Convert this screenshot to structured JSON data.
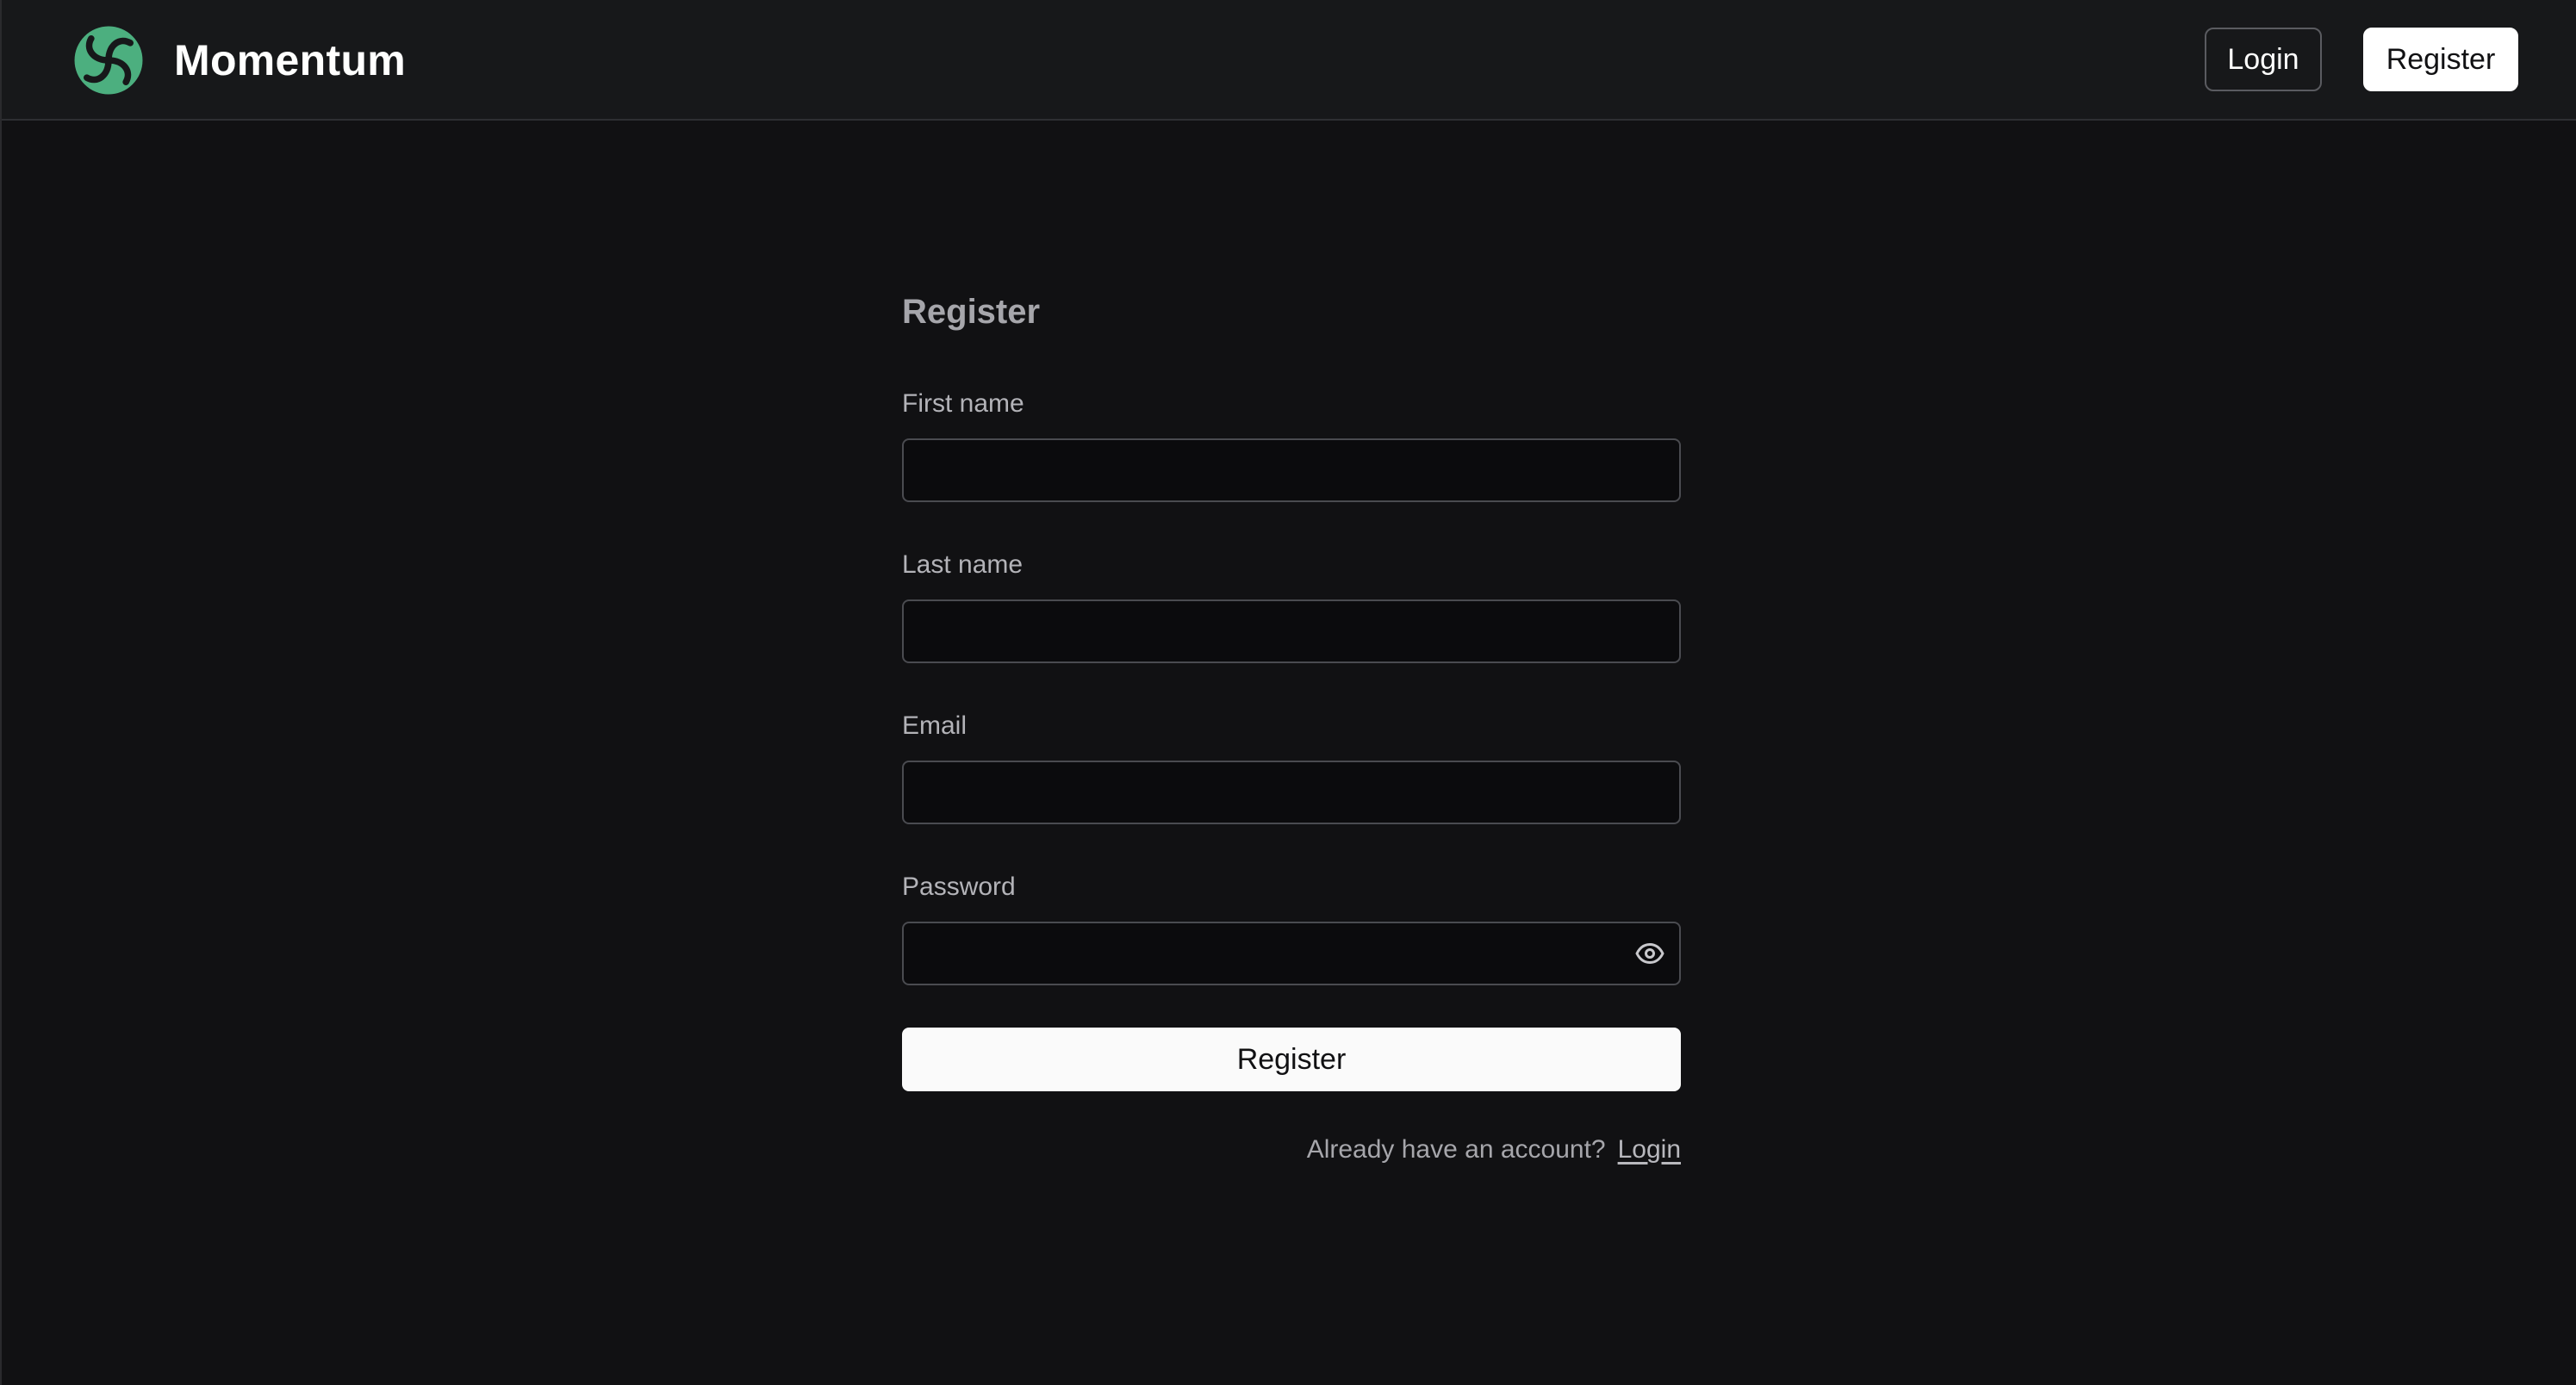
{
  "header": {
    "brand_name": "Momentum",
    "brand_icon": "momentum-logo-icon",
    "accent_color": "#4caf7f",
    "login_label": "Login",
    "register_label": "Register"
  },
  "form": {
    "title": "Register",
    "fields": [
      {
        "label": "First name",
        "value": "",
        "placeholder": ""
      },
      {
        "label": "Last name",
        "value": "",
        "placeholder": ""
      },
      {
        "label": "Email",
        "value": "",
        "placeholder": ""
      },
      {
        "label": "Password",
        "value": "",
        "placeholder": "",
        "toggle_icon": "eye-icon"
      }
    ],
    "submit_label": "Register",
    "footer_prompt": "Already have an account?",
    "footer_link": "Login"
  }
}
